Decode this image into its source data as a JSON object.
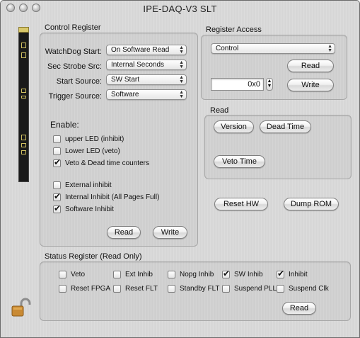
{
  "window": {
    "title": "IPE-DAQ-V3 SLT"
  },
  "control_register": {
    "title": "Control Register",
    "rows": [
      {
        "label": "WatchDog Start:",
        "value": "On Software Read"
      },
      {
        "label": "Sec Strobe Src:",
        "value": "Internal Seconds"
      },
      {
        "label": "Start Source:",
        "value": "SW Start"
      },
      {
        "label": "Trigger Source:",
        "value": "Software"
      }
    ],
    "enable_label": "Enable:",
    "checks": [
      {
        "label": "upper LED (inhibit)",
        "checked": false
      },
      {
        "label": "Lower LED (veto)",
        "checked": false
      },
      {
        "label": "Veto & Dead time counters",
        "checked": true
      },
      {
        "label": "External inhibit",
        "checked": false
      },
      {
        "label": "Internal Inhibit (All Pages Full)",
        "checked": true
      },
      {
        "label": "Software Inhibit",
        "checked": true
      }
    ],
    "read_label": "Read",
    "write_label": "Write"
  },
  "register_access": {
    "title": "Register Access",
    "selected": "Control",
    "value": "0x0",
    "read_label": "Read",
    "write_label": "Write"
  },
  "read_box": {
    "title": "Read",
    "version_label": "Version",
    "dead_time_label": "Dead Time",
    "veto_time_label": "Veto Time"
  },
  "actions": {
    "reset_hw_label": "Reset HW",
    "dump_rom_label": "Dump ROM"
  },
  "status_register": {
    "title": "Status Register (Read Only)",
    "checks": [
      {
        "label": "Veto",
        "checked": false
      },
      {
        "label": "Ext Inhib",
        "checked": false
      },
      {
        "label": "Nopg Inhib",
        "checked": false
      },
      {
        "label": "SW Inhib",
        "checked": true
      },
      {
        "label": "Inhibit",
        "checked": true
      },
      {
        "label": "Reset FPGA",
        "checked": false
      },
      {
        "label": "Reset FLT",
        "checked": false
      },
      {
        "label": "Standby FLT",
        "checked": false
      },
      {
        "label": "Suspend PLL",
        "checked": false
      },
      {
        "label": "Suspend Clk",
        "checked": false
      }
    ],
    "read_label": "Read"
  },
  "icons": [
    "board-strip-icon",
    "padlock-icon"
  ]
}
